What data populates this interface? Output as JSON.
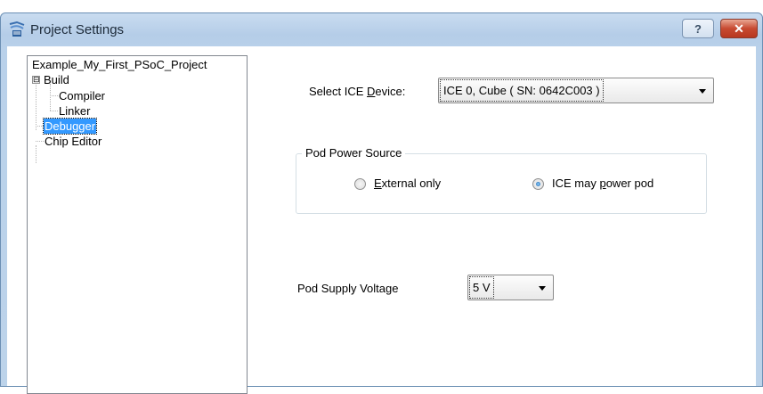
{
  "window": {
    "title": "Project Settings",
    "app_icon": "psoc-designer-icon",
    "help_label": "?",
    "close_label": "✕"
  },
  "tree": {
    "root": "Example_My_First_PSoC_Project",
    "items": [
      {
        "label": "Build",
        "expander": "⊟"
      },
      {
        "label": "Compiler"
      },
      {
        "label": "Linker"
      },
      {
        "label": "Debugger",
        "selected": true
      },
      {
        "label": "Chip Editor"
      }
    ]
  },
  "debugger": {
    "ice_device_label_pre": "Select ICE ",
    "ice_device_label_ul": "D",
    "ice_device_label_post": "evice:",
    "ice_device_value": "ICE 0, Cube ( SN: 0642C003 )",
    "pod_power_title": "Pod Power Source",
    "radio_external_ul": "E",
    "radio_external_post": "xternal only",
    "radio_ice_pre": "ICE may ",
    "radio_ice_ul": "p",
    "radio_ice_post": "ower pod",
    "selected_power": "ICE may power pod",
    "pod_voltage_label": "Pod Supply Voltage",
    "pod_voltage_value": "5 V"
  },
  "colors": {
    "selection": "#3399ff",
    "close_button": "#c74a31",
    "titlebar": "#c9dcf0"
  }
}
